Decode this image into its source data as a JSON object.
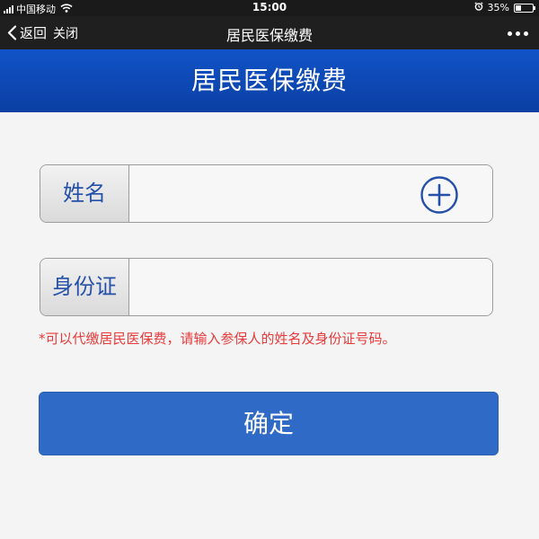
{
  "status_bar": {
    "carrier": "中国移动",
    "time": "15:00",
    "battery": "35%",
    "battery_level": 0.35
  },
  "nav": {
    "back_label": "返回",
    "close_label": "关闭",
    "title": "居民医保缴费"
  },
  "banner": {
    "title": "居民医保缴费"
  },
  "form": {
    "name_label": "姓名",
    "name_value": "",
    "id_label": "身份证",
    "id_value": "",
    "hint": "*可以代缴居民医保费，请输入参保人的姓名及身份证号码。",
    "confirm_label": "确定"
  },
  "colors": {
    "banner": "#0a3fa3",
    "label_text": "#2450a8",
    "hint": "#e83a3a",
    "confirm": "#2f6bc6"
  },
  "icons": [
    "signal-icon",
    "wifi-icon",
    "alarm-icon",
    "battery-icon",
    "back-chevron-icon",
    "more-icon",
    "add-circle-icon"
  ]
}
